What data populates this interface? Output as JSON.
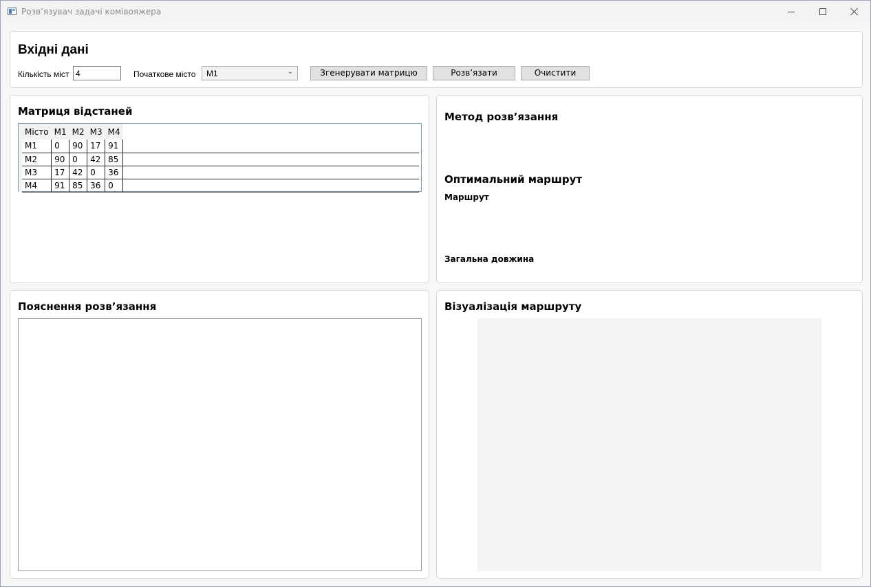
{
  "window": {
    "title": "Розв’язувач задачі комівояжера"
  },
  "input": {
    "heading": "Вхідні дані",
    "count_label": "Кількість міст",
    "count_value": "4",
    "start_label": "Початкове місто",
    "start_value": "M1",
    "generate_button": "Згенерувати матрицю",
    "solve_button": "Розв’язати",
    "clear_button": "Очистити"
  },
  "matrix": {
    "heading": "Матриця відстаней",
    "columns": [
      "Місто",
      "M1",
      "M2",
      "M3",
      "M4"
    ],
    "rows": [
      [
        "M1",
        "0",
        "90",
        "17",
        "91"
      ],
      [
        "M2",
        "90",
        "0",
        "42",
        "85"
      ],
      [
        "M3",
        "17",
        "42",
        "0",
        "36"
      ],
      [
        "M4",
        "91",
        "85",
        "36",
        "0"
      ]
    ]
  },
  "result": {
    "method_heading": "Метод розв’язання",
    "route_heading": "Оптимальний маршрут",
    "route_label": "Маршрут",
    "length_label": "Загальна довжина"
  },
  "explanation": {
    "heading": "Пояснення розв’язання"
  },
  "visualization": {
    "heading": "Візуалізація маршруту"
  }
}
